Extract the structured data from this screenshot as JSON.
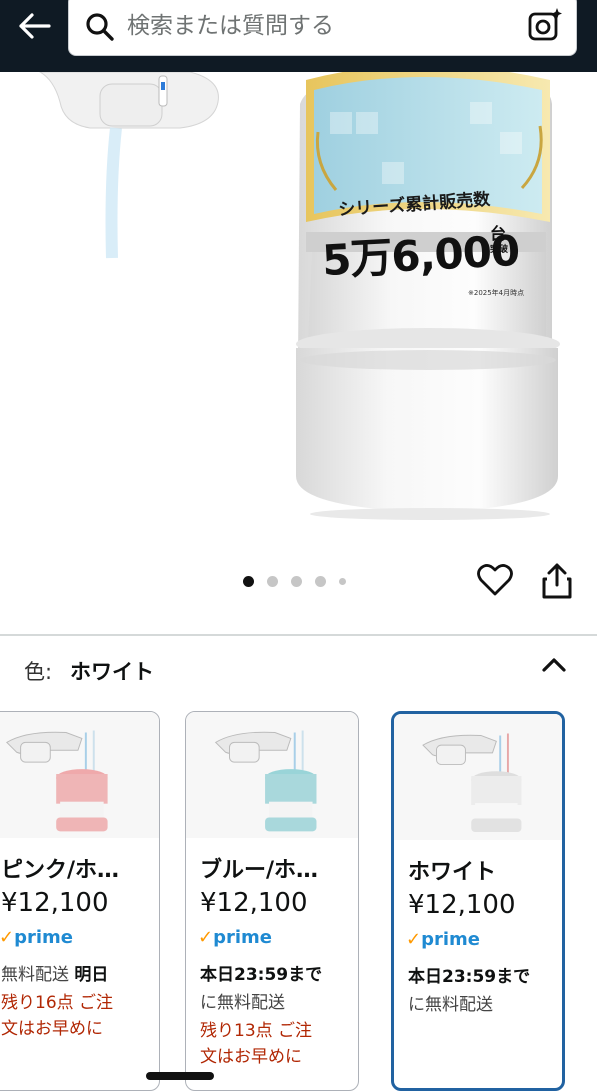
{
  "search": {
    "placeholder": "検索または質問する"
  },
  "hero": {
    "banner_title": "シリーズ累計販売数",
    "banner_count": "5万6,000",
    "banner_unit": "台",
    "banner_suffix": "突破",
    "banner_note": "※2025年4月時点"
  },
  "gallery": {
    "image_count": 5,
    "active_index": 0
  },
  "color": {
    "label": "色:",
    "value": "ホワイト"
  },
  "variants": [
    {
      "name": "ピンク/ホ…",
      "price": "¥12,100",
      "prime": "prime",
      "line1_plain": "無料配送 ",
      "line1_bold": "明日",
      "line2": "残り16点 ご注",
      "line3": "文はお早めに",
      "accent": "#e9b4b4"
    },
    {
      "name": "ブルー/ホ…",
      "price": "¥12,100",
      "prime": "prime",
      "line1_bold": "本日23:59まで",
      "line2_plain": "に無料配送",
      "line3": "残り13点 ご注",
      "line4": "文はお早めに",
      "accent": "#a9d8dc"
    },
    {
      "name": "ホワイト",
      "price": "¥12,100",
      "prime": "prime",
      "line1_bold": "本日23:59まで",
      "line2_plain": "に無料配送",
      "accent": "#e8e8e8",
      "selected": true
    }
  ],
  "colors": {
    "header_bg": "#0f1a24",
    "prime_blue": "#1f8ad2",
    "selected_border": "#2162a1",
    "urgent_red": "#b12704"
  }
}
